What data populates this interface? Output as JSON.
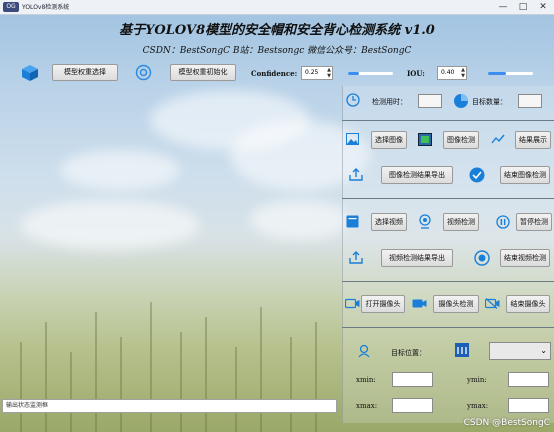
{
  "window": {
    "title": "YOLOv8检测系统",
    "logo_text": "OG"
  },
  "header": {
    "title": "基于YOLOV8模型的安全帽和安全背心检测系统 v1.0",
    "subtitle": "CSDN：BestSongC    B站：Bestsongc    微信公众号：BestSongC"
  },
  "toolbar": {
    "model_select_label": "模型权重选择",
    "model_init_label": "模型权重初始化",
    "confidence_label": "Confidence:",
    "confidence_value": "0.25",
    "confidence_level": 0.25,
    "iou_label": "IOU:",
    "iou_value": "0.40",
    "iou_level": 0.4
  },
  "info": {
    "time_label": "检测用时：",
    "count_label": "目标数量："
  },
  "image_section": {
    "select_label": "选择图像",
    "detect_label": "图像检测",
    "show_label": "结果展示",
    "export_label": "图像检测结果导出",
    "end_label": "结束图像检测"
  },
  "video_section": {
    "select_label": "选择视频",
    "detect_label": "视频检测",
    "pause_label": "暂停检测",
    "export_label": "视频检测结果导出",
    "end_label": "结束视频检测"
  },
  "camera_section": {
    "open_label": "打开摄像头",
    "detect_label": "摄像头检测",
    "end_label": "结束摄像头"
  },
  "target": {
    "position_label": "目标位置：",
    "select_value": "",
    "xmin_label": "xmin:",
    "ymin_label": "ymin:",
    "xmax_label": "xmax:",
    "ymax_label": "ymax:"
  },
  "status_bar": {
    "text": "输出状态监测框"
  },
  "watermark": {
    "text": "CSDN @BestSongC"
  },
  "colors": {
    "accent": "#3c8df0",
    "icon_blue": "#1a7fd9"
  }
}
